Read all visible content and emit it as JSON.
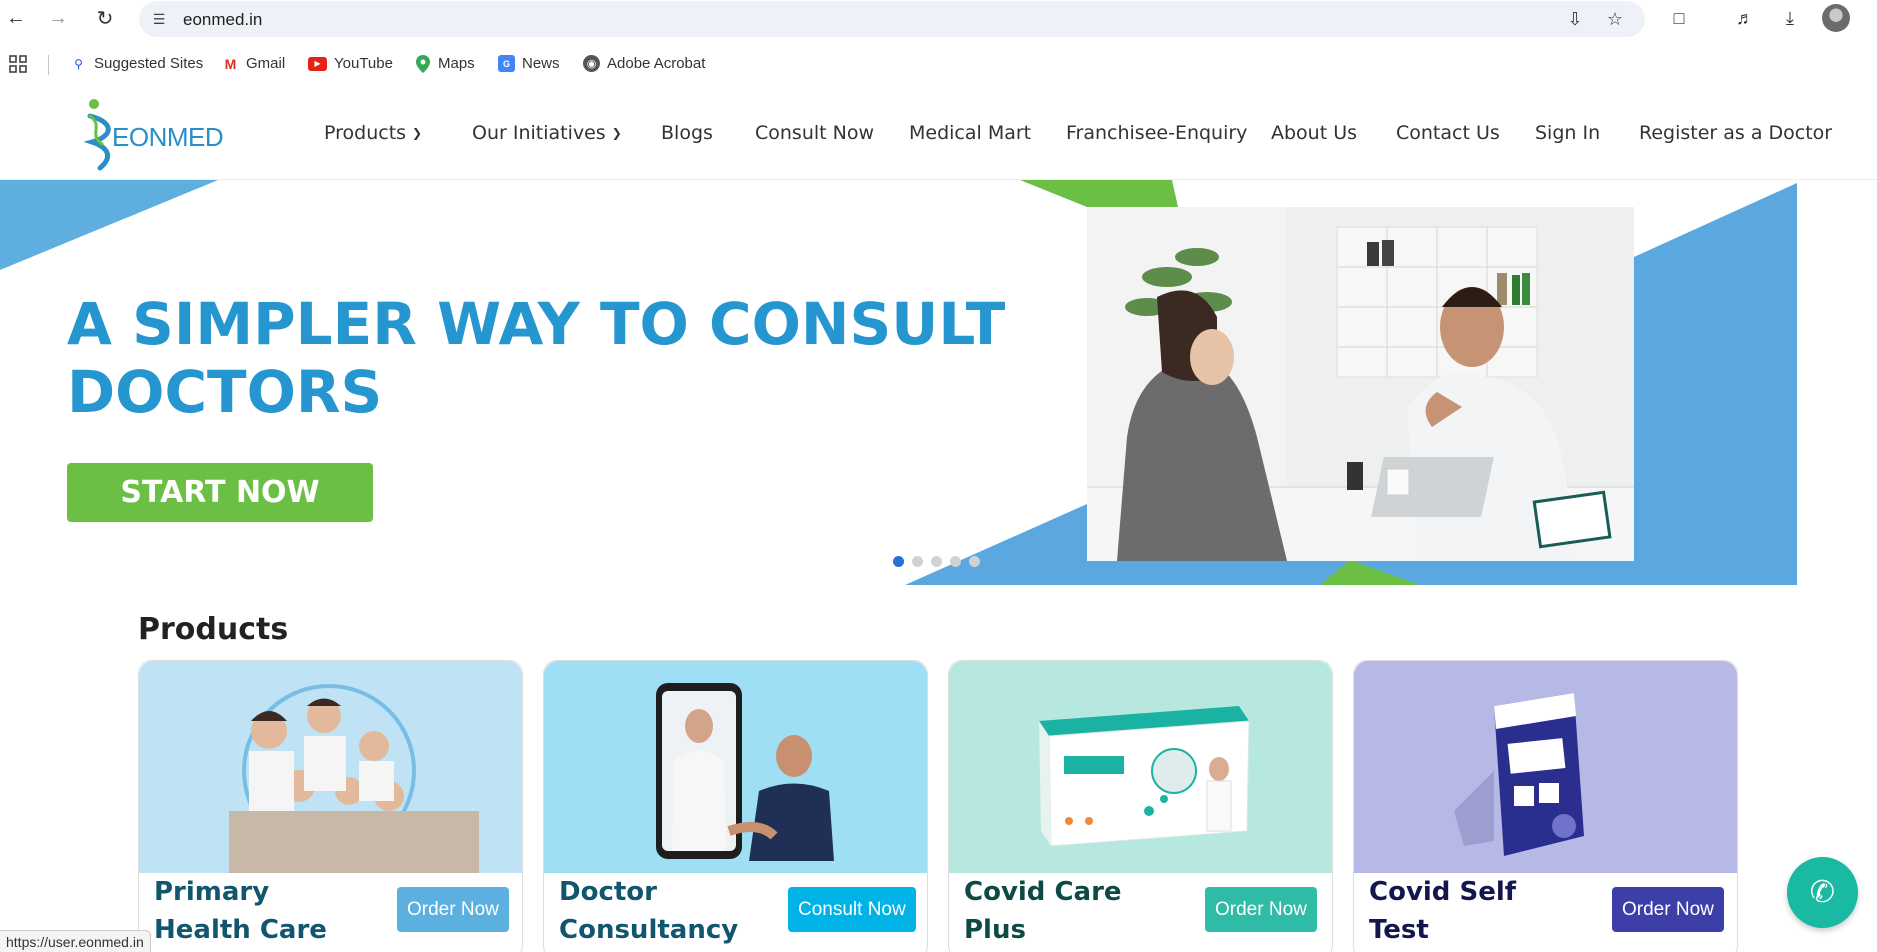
{
  "browser": {
    "url": "eonmed.in",
    "status_url": "https://user.eonmed.in"
  },
  "bookmarks": [
    {
      "label": "Suggested Sites",
      "icon": "search-icon"
    },
    {
      "label": "Gmail",
      "icon": "gmail-icon"
    },
    {
      "label": "YouTube",
      "icon": "youtube-icon"
    },
    {
      "label": "Maps",
      "icon": "maps-icon"
    },
    {
      "label": "News",
      "icon": "news-icon"
    },
    {
      "label": "Adobe Acrobat",
      "icon": "globe-icon"
    }
  ],
  "site": {
    "logo_text": "EONMED",
    "nav": [
      {
        "label": "Products",
        "dropdown": true
      },
      {
        "label": "Our Initiatives",
        "dropdown": true
      },
      {
        "label": "Blogs"
      },
      {
        "label": "Consult Now"
      },
      {
        "label": "Medical Mart"
      },
      {
        "label": "Franchisee-Enquiry"
      },
      {
        "label": "About Us"
      },
      {
        "label": "Contact Us"
      },
      {
        "label": "Sign In"
      },
      {
        "label": "Register as a Doctor"
      }
    ]
  },
  "hero": {
    "title_line1": "A SIMPLER WAY TO CONSULT",
    "title_line2": "DOCTORS",
    "cta": "START NOW",
    "slides": 5,
    "active_slide": 1
  },
  "products": {
    "title": "Products",
    "items": [
      {
        "name_line1": "Primary",
        "name_line2": "Health Care",
        "button": "Order Now",
        "button_color": "#5bb0e0",
        "name_color": "#12556e",
        "bg": "#bfe2f4"
      },
      {
        "name_line1": "Doctor",
        "name_line2": "Consultancy",
        "button": "Consult Now",
        "button_color": "#00b3e6",
        "name_color": "#12556e",
        "bg": "#9fdff6"
      },
      {
        "name_line1": "Covid Care",
        "name_line2": "Plus",
        "button": "Order Now",
        "button_color": "#30bba6",
        "name_color": "#0e4a44",
        "bg": "#b6e8df"
      },
      {
        "name_line1": "Covid Self",
        "name_line2": "Test",
        "button": "Order Now",
        "button_color": "#3d3fa8",
        "name_color": "#14174d",
        "bg": "#b6b8e6"
      }
    ]
  },
  "colors": {
    "brand_blue": "#2596cf",
    "cta_green": "#6bbf45",
    "fab_teal": "#19b9a2"
  }
}
